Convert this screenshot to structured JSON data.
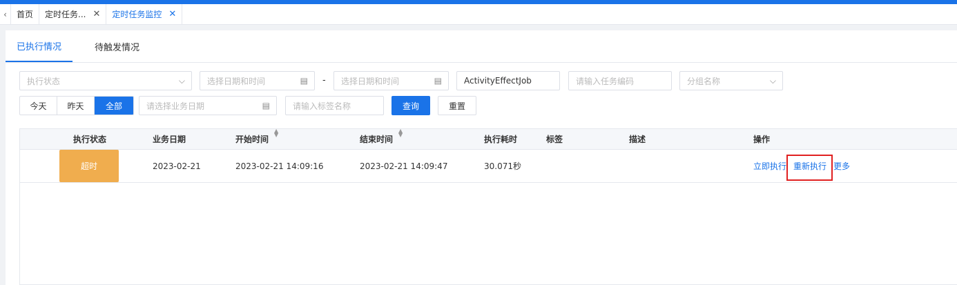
{
  "tabs": [
    {
      "label": "首页"
    },
    {
      "label": "定时任务..."
    },
    {
      "label": "定时任务监控"
    }
  ],
  "subtabs": [
    "已执行情况",
    "待触发情况"
  ],
  "filters": {
    "status_placeholder": "执行状态",
    "date_start_placeholder": "选择日期和时间",
    "date_end_placeholder": "选择日期和时间",
    "date_sep": "-",
    "job_name_value": "ActivityEffectJob",
    "task_code_placeholder": "请输入任务编码",
    "group_placeholder": "分组名称",
    "quick_dates": [
      "今天",
      "昨天",
      "全部"
    ],
    "biz_date_placeholder": "请选择业务日期",
    "tag_placeholder": "请输入标签名称",
    "query_label": "查询",
    "reset_label": "重置"
  },
  "table": {
    "columns": [
      "执行状态",
      "业务日期",
      "开始时间",
      "结束时间",
      "执行耗时",
      "标签",
      "描述",
      "操作"
    ],
    "rows": [
      {
        "status": "超时",
        "biz_date": "2023-02-21",
        "start": "2023-02-21 14:09:16",
        "end": "2023-02-21 14:09:47",
        "duration": "30.071秒",
        "tag": "",
        "desc": "",
        "actions": [
          "立即执行",
          "重新执行",
          "更多"
        ]
      }
    ]
  },
  "colors": {
    "accent": "#1a73e8",
    "badge_timeout": "#f0ad4e",
    "highlight": "#e02020"
  }
}
